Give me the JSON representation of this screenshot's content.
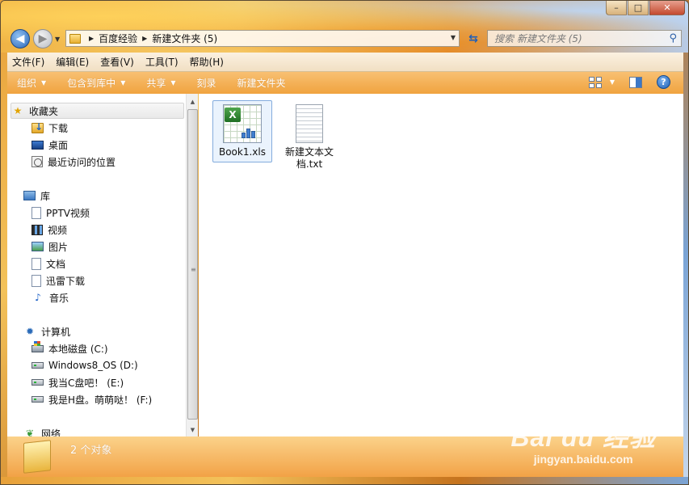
{
  "window": {
    "controls": {
      "minimize": "–",
      "maximize": "□",
      "close": "✕"
    }
  },
  "address": {
    "breadcrumbs": [
      "百度经验",
      "新建文件夹 (5)"
    ],
    "search_placeholder": "搜索 新建文件夹 (5)"
  },
  "menu": [
    "文件(F)",
    "编辑(E)",
    "查看(V)",
    "工具(T)",
    "帮助(H)"
  ],
  "toolbar": {
    "organize": "组织",
    "include_library": "包含到库中",
    "share": "共享",
    "burn": "刻录",
    "new_folder": "新建文件夹",
    "help": "?"
  },
  "nav": {
    "favorites": {
      "label": "收藏夹",
      "items": [
        "下载",
        "桌面",
        "最近访问的位置"
      ]
    },
    "libraries": {
      "label": "库",
      "items": [
        "PPTV视频",
        "视频",
        "图片",
        "文档",
        "迅雷下载",
        "音乐"
      ]
    },
    "computer": {
      "label": "计算机",
      "items": [
        "本地磁盘 (C:)",
        "Windows8_OS (D:)",
        "我当C盘吧！ (E:)",
        "我是H盘。萌萌哒！ (F:)"
      ]
    },
    "network": {
      "label": "网络"
    }
  },
  "files": [
    {
      "name": "Book1.xls",
      "type": "excel-icon",
      "selected": true
    },
    {
      "name": "新建文本文档.txt",
      "type": "text-file-icon",
      "selected": false
    }
  ],
  "details": {
    "count_text": "2 个对象"
  },
  "watermark": {
    "logo": "Bai du 经验",
    "url": "jingyan.baidu.com"
  }
}
